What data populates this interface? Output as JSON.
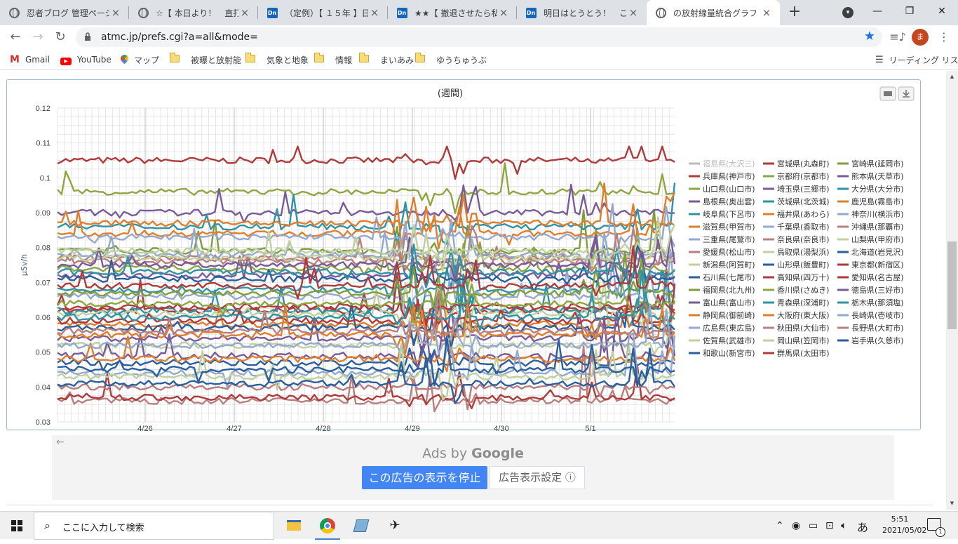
{
  "browser": {
    "tabs": [
      {
        "title": "忍者ブログ 管理ページ -",
        "icon": "globe-icon",
        "active": false
      },
      {
        "title": "☆【 本日より！　直打ち",
        "icon": "globe-icon",
        "active": false
      },
      {
        "title": "（定例）【 １５年 】日",
        "icon": "dn-icon",
        "active": false
      },
      {
        "title": "★★【 撤退させたら私の",
        "icon": "dn-icon",
        "active": false
      },
      {
        "title": "明日はとうとう！　この際",
        "icon": "dn-icon",
        "active": false
      },
      {
        "title": "の放射線量統合グラフ",
        "icon": "globe-icon",
        "active": true
      }
    ],
    "url": "atmc.jp/prefs.cgi?a=all&mode=",
    "profile_initial": "ま",
    "bookmarks": [
      {
        "label": "Gmail",
        "icon": "gmail-icon"
      },
      {
        "label": "YouTube",
        "icon": "youtube-icon"
      },
      {
        "label": "マップ",
        "icon": "maps-icon"
      },
      {
        "label": "被曝と放射能",
        "icon": "folder-icon"
      },
      {
        "label": "気象と地象",
        "icon": "folder-icon"
      },
      {
        "label": "情報",
        "icon": "folder-icon"
      },
      {
        "label": "まいあみ",
        "icon": "folder-icon"
      },
      {
        "label": "ゆうちゅうぶ",
        "icon": "folder-icon"
      }
    ],
    "reading_list": "リーディング リスト"
  },
  "chart_data": {
    "type": "line",
    "title": "(週間)",
    "ylabel": "μSv/h",
    "xlabel": "",
    "ylim": [
      0.03,
      0.12
    ],
    "y_ticks": [
      "0.12",
      "0.11",
      "0.1",
      "0.09",
      "0.08",
      "0.07",
      "0.06",
      "0.05",
      "0.04",
      "0.03"
    ],
    "x_ticks": [
      "4/26",
      "4/27",
      "4/28",
      "4/29",
      "4/30",
      "5/1"
    ],
    "grid": true,
    "legend_position": "right",
    "series": [
      {
        "name": "福島県(大沢三)",
        "color": "#bbbbbb",
        "base": null
      },
      {
        "name": "宮城県(丸森町)",
        "color": "#b03a3a",
        "base": 0.105
      },
      {
        "name": "宮崎県(延岡市)",
        "color": "#7f9e3a",
        "base": 0.079
      },
      {
        "name": "兵庫県(神戸市)",
        "color": "#b03a3a",
        "base": 0.062
      },
      {
        "name": "京都府(京都市)",
        "color": "#8ea63e",
        "base": 0.074
      },
      {
        "name": "熊本県(天草市)",
        "color": "#7a5b9a",
        "base": 0.072
      },
      {
        "name": "山口県(山口市)",
        "color": "#8ea63e",
        "base": 0.096
      },
      {
        "name": "埼玉県(三郷市)",
        "color": "#7a5b9a",
        "base": 0.054
      },
      {
        "name": "大分県(大分市)",
        "color": "#2f93a8",
        "base": 0.068
      },
      {
        "name": "島根県(奥出雲)",
        "color": "#7a5b9a",
        "base": 0.09
      },
      {
        "name": "茨城県(北茨城)",
        "color": "#2f93a8",
        "base": 0.062
      },
      {
        "name": "鹿児島(霧島市)",
        "color": "#e07e2c",
        "base": 0.058
      },
      {
        "name": "岐阜県(下呂市)",
        "color": "#2f93a8",
        "base": 0.086
      },
      {
        "name": "福井県(あわら)",
        "color": "#e07e2c",
        "base": 0.084
      },
      {
        "name": "神奈川(横浜市)",
        "color": "#93a9cf",
        "base": 0.083
      },
      {
        "name": "滋賀県(甲賀市)",
        "color": "#e07e2c",
        "base": 0.087
      },
      {
        "name": "千葉県(香取市)",
        "color": "#93a9cf",
        "base": 0.066
      },
      {
        "name": "沖縄県(那覇市)",
        "color": "#b97e7e",
        "base": 0.077
      },
      {
        "name": "三重県(尾鷲市)",
        "color": "#93a9cf",
        "base": 0.078
      },
      {
        "name": "奈良県(奈良市)",
        "color": "#b97e7e",
        "base": 0.076
      },
      {
        "name": "山梨県(甲府市)",
        "color": "#c0d19e",
        "base": 0.077
      },
      {
        "name": "愛媛県(松山市)",
        "color": "#b97e7e",
        "base": 0.036
      },
      {
        "name": "鳥取県(湯梨浜)",
        "color": "#c0d19e",
        "base": 0.061
      },
      {
        "name": "北海道(岩見沢)",
        "color": "#2a5f9e",
        "base": 0.047
      },
      {
        "name": "新潟県(阿賀町)",
        "color": "#c0d19e",
        "base": 0.052
      },
      {
        "name": "山形県(飯豊町)",
        "color": "#2a5f9e",
        "base": 0.057
      },
      {
        "name": "東京都(新宿区)",
        "color": "#b03a3a",
        "base": 0.037
      },
      {
        "name": "石川県(七尾市)",
        "color": "#2a5f9e",
        "base": 0.071
      },
      {
        "name": "高知県(四万十)",
        "color": "#b03a3a",
        "base": 0.059
      },
      {
        "name": "愛知県(名古屋)",
        "color": "#b03a3a",
        "base": 0.063
      },
      {
        "name": "福岡県(北九州)",
        "color": "#7f9e3a",
        "base": 0.067
      },
      {
        "name": "香川県(さぬき)",
        "color": "#8ea63e",
        "base": 0.064
      },
      {
        "name": "徳島県(三好市)",
        "color": "#7a5b9a",
        "base": 0.049
      },
      {
        "name": "富山県(富山市)",
        "color": "#7a5b9a",
        "base": 0.075
      },
      {
        "name": "青森県(深浦町)",
        "color": "#2f93a8",
        "base": 0.06
      },
      {
        "name": "栃木県(那須塩)",
        "color": "#2f93a8",
        "base": 0.073
      },
      {
        "name": "静岡県(御前崎)",
        "color": "#e07e2c",
        "base": 0.055
      },
      {
        "name": "大阪府(東大阪)",
        "color": "#e07e2c",
        "base": 0.048
      },
      {
        "name": "長崎県(壱岐市)",
        "color": "#93a9cf",
        "base": 0.052
      },
      {
        "name": "広島県(東広島)",
        "color": "#93a9cf",
        "base": 0.044
      },
      {
        "name": "秋田県(大仙市)",
        "color": "#b97e7e",
        "base": 0.04
      },
      {
        "name": "長野県(大町市)",
        "color": "#b97e7e",
        "base": 0.056
      },
      {
        "name": "佐賀県(武雄市)",
        "color": "#c0d19e",
        "base": 0.043
      },
      {
        "name": "岡山県(笠岡市)",
        "color": "#c0d19e",
        "base": 0.079
      },
      {
        "name": "岩手県(久慈市)",
        "color": "#2a5f9e",
        "base": 0.045
      },
      {
        "name": "和歌山(新宮市)",
        "color": "#2a5f9e",
        "base": 0.041
      },
      {
        "name": "群馬県(太田市)",
        "color": "#b03a3a",
        "base": 0.069
      }
    ]
  },
  "ads": {
    "ads_by": "Ads by",
    "google": "Google",
    "stop_label": "この広告の表示を停止",
    "settings_label": "広告表示設定 ⓘ"
  },
  "taskbar": {
    "search_placeholder": "ここに入力して検索",
    "ime": "あ",
    "time": "5:51",
    "date": "2021/05/02",
    "notification_count": "1"
  }
}
